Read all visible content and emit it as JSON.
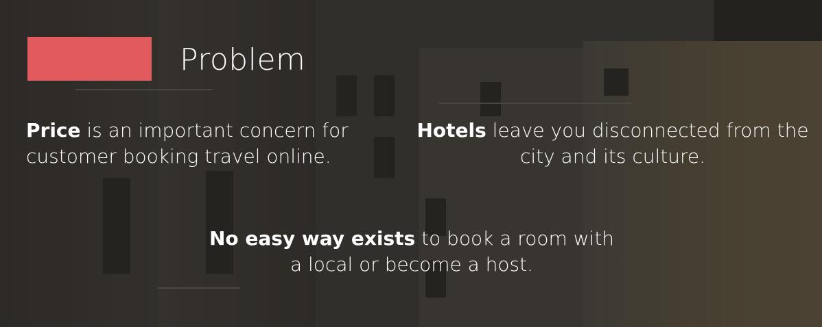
{
  "slide": {
    "title": "Problem",
    "accent_color": "#e05a5e",
    "points": [
      {
        "bold": "Price",
        "rest": " is an important concern for customer booking travel online."
      },
      {
        "bold": "Hotels",
        "rest": " leave you disconnected from the city and its culture."
      },
      {
        "bold": "No easy way exists",
        "rest": " to book a room with a local or become a host."
      }
    ]
  }
}
